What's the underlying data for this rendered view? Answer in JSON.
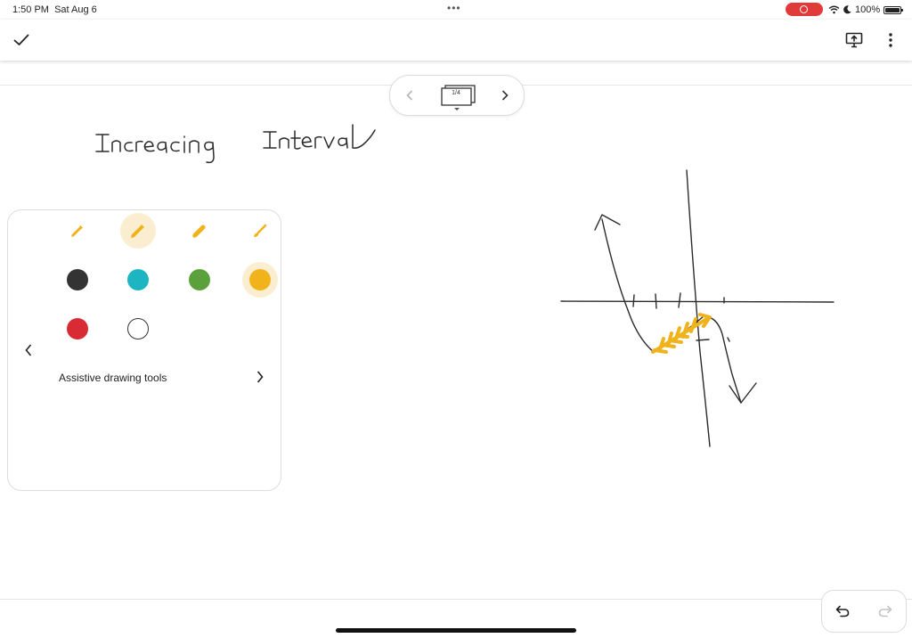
{
  "status_bar": {
    "time": "1:50 PM",
    "date": "Sat Aug 6",
    "battery": "100%",
    "battery_level_percent": 100,
    "icons": [
      "ellipsis-icon",
      "screen-record-icon",
      "wifi-icon",
      "moon-icon",
      "battery-icon"
    ]
  },
  "toolbar": {
    "left_icon": "checkmark-icon",
    "right_icons": [
      "present-screen-icon",
      "more-vertical-icon"
    ]
  },
  "page_nav": {
    "label": "1/4",
    "icons": [
      "chevron-left-icon",
      "pages-icon",
      "chevron-right-icon"
    ]
  },
  "palette": {
    "pens": [
      {
        "icon": "pen-fine-icon",
        "color": "#F0B31C",
        "selected": false
      },
      {
        "icon": "pen-medium-icon",
        "color": "#F0B31C",
        "selected": true
      },
      {
        "icon": "marker-icon",
        "color": "#F0B31C",
        "selected": false
      },
      {
        "icon": "brush-icon",
        "color": "#F0B31C",
        "selected": false
      }
    ],
    "colors": [
      {
        "name": "black",
        "hex": "#333333",
        "selected": false
      },
      {
        "name": "teal",
        "hex": "#1CB5C1",
        "selected": false
      },
      {
        "name": "green",
        "hex": "#5AA13B",
        "selected": false
      },
      {
        "name": "yellow",
        "hex": "#F0B31C",
        "selected": true
      },
      {
        "name": "red",
        "hex": "#D92B34",
        "selected": false
      },
      {
        "name": "white",
        "hex": "#FFFFFF",
        "selected": false
      }
    ],
    "assistive_label": "Assistive drawing tools"
  },
  "canvas": {
    "handwriting": "Increasing Interval",
    "ink_color": "#2b2b2b",
    "highlight_color": "#F0B31C"
  },
  "bottom": {
    "icons": [
      "undo-icon",
      "redo-icon"
    ]
  }
}
